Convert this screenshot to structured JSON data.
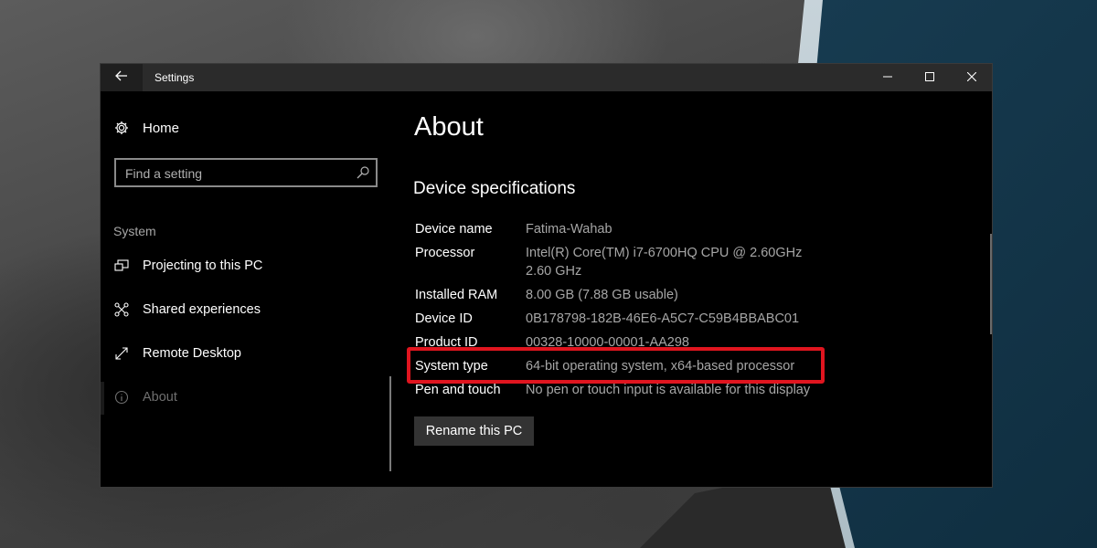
{
  "window": {
    "title": "Settings",
    "controls": {
      "minimize": "minimize-icon",
      "maximize": "maximize-icon",
      "close": "close-icon"
    }
  },
  "sidebar": {
    "home_label": "Home",
    "search": {
      "placeholder": "Find a setting"
    },
    "section_label": "System",
    "items": [
      {
        "label": "Projecting to this PC",
        "icon": "projector-icon"
      },
      {
        "label": "Shared experiences",
        "icon": "shared-experiences-icon"
      },
      {
        "label": "Remote Desktop",
        "icon": "remote-desktop-icon"
      },
      {
        "label": "About",
        "icon": "info-icon",
        "state": "disabled"
      }
    ]
  },
  "main": {
    "title": "About",
    "section_title": "Device specifications",
    "specs": [
      {
        "label": "Device name",
        "value": "Fatima-Wahab"
      },
      {
        "label": "Processor",
        "value": "Intel(R) Core(TM) i7-6700HQ CPU @ 2.60GHz",
        "value2": "2.60 GHz"
      },
      {
        "label": "Installed RAM",
        "value": "8.00 GB (7.88 GB usable)"
      },
      {
        "label": "Device ID",
        "value": "0B178798-182B-46E6-A5C7-C59B4BBABC01"
      },
      {
        "label": "Product ID",
        "value": "00328-10000-00001-AA298"
      },
      {
        "label": "System type",
        "value": "64-bit operating system, x64-based processor"
      },
      {
        "label": "Pen and touch",
        "value": "No pen or touch input is available for this display"
      }
    ],
    "rename_button": "Rename this PC"
  },
  "colors": {
    "highlight": "#e0151f",
    "window_bg": "#000000",
    "titlebar_bg": "#2b2b2b"
  }
}
